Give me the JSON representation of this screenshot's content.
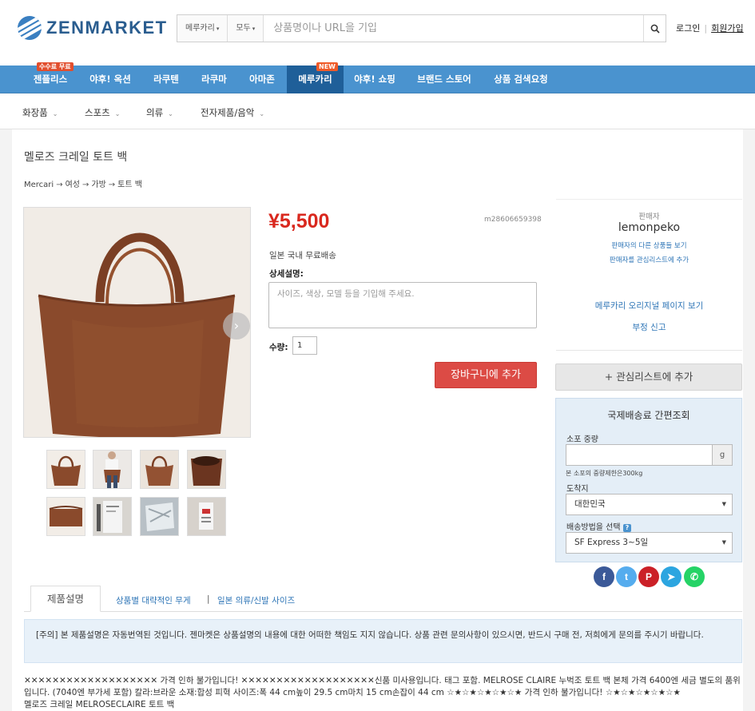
{
  "header": {
    "logo_text": "ZENMARKET",
    "search": {
      "site_select": "메루카리",
      "category_select": "모두",
      "placeholder": "상품명이나 URL을 기입"
    },
    "auth": {
      "login": "로그인",
      "separator": "|",
      "signup": "회원가입"
    }
  },
  "main_nav": {
    "items": [
      {
        "label": "젠플리스",
        "badge": "수수료 무료"
      },
      {
        "label": "야후! 옥션"
      },
      {
        "label": "라쿠텐"
      },
      {
        "label": "라쿠마"
      },
      {
        "label": "아마존"
      },
      {
        "label": "메루카리",
        "badge": "NEW",
        "active": true
      },
      {
        "label": "야후! 쇼핑"
      },
      {
        "label": "브랜드 스토어"
      },
      {
        "label": "상품 검색요청"
      }
    ]
  },
  "sub_nav": {
    "categories": [
      "화장품",
      "스포츠",
      "의류",
      "전자제품/음악"
    ]
  },
  "product": {
    "title": "멜로즈 크레일 토트 백",
    "breadcrumb": [
      "Mercari",
      "여성",
      "가방",
      "토트 백"
    ],
    "price": "¥5,500",
    "item_id": "m28606659398",
    "shipping_note": "일본 국내 무료배송",
    "details_label": "상세설명:",
    "details_placeholder": "사이즈, 색상, 모델 등을 기입해 주세요.",
    "quantity_label": "수량:",
    "quantity_value": "1",
    "add_to_cart": "장바구니에 추가",
    "image_count": 9
  },
  "seller": {
    "label": "판매자",
    "name": "lemonpeko",
    "other_items": "판매자의 다른 상품들 보기",
    "add_favorite": "판매자를 관심리스트에 추가",
    "original_page": "메루카리 오리지널 페이지 보기",
    "report": "부정 신고"
  },
  "wishlist_button": "+ 관심리스트에 추가",
  "shipping_calc": {
    "title": "국제배송료 간편조회",
    "weight_label": "소포 중량",
    "weight_unit": "g",
    "weight_note": "본 소포의 중량제한은300kg",
    "dest_label": "도착지",
    "dest_value": "대한민국",
    "method_label": "배송방법을 선택",
    "help": "?",
    "method_value": "SF Express 3~5일"
  },
  "social": [
    {
      "icon": "facebook-icon",
      "glyph": "f",
      "color": "#3b5998"
    },
    {
      "icon": "twitter-icon",
      "glyph": "t",
      "color": "#55acee"
    },
    {
      "icon": "pinterest-icon",
      "glyph": "P",
      "color": "#cb2027"
    },
    {
      "icon": "telegram-icon",
      "glyph": "➤",
      "color": "#2ca5e0"
    },
    {
      "icon": "whatsapp-icon",
      "glyph": "✆",
      "color": "#25d366"
    }
  ],
  "tabs": {
    "active": "제품설명",
    "links": [
      "상품별 대략적인 무게",
      "일본 의류/신발 사이즈"
    ],
    "separator": "|"
  },
  "notice": "[주의] 본 제품설명은 자동번역된 것입니다. 젠마켓은 상품설명의 내용에 대한 어떠한 책임도 지지 않습니다. 상품 관련 문의사항이 있으시면, 반드시 구매 전, 저희에게 문의를 주시기 바랍니다.",
  "description": [
    "✕✕✕✕✕✕✕✕✕✕✕✕✕✕✕✕✕✕✕ 가격 인하 불가입니다! ✕✕✕✕✕✕✕✕✕✕✕✕✕✕✕✕✕✕✕신품 미사용입니다. 태그 포함. MELROSE CLAIRE 누벅조 토트 백 본체 가격 6400엔 세금 별도의 품위입니다. (7040엔 부가세 포함) 칼라:브라운 소재:합성 피혁 사이즈:폭 44 cm높이 29.5 cm마치 15 cm손잡이 44 cm ☆★☆★☆★☆★☆★ 가격 인하 불가입니다! ☆★☆★☆★☆★☆★",
    "멜로즈 크레일 MELROSECLAIRE 토트 백"
  ],
  "colors": {
    "nav_blue": "#4a93cf",
    "nav_active": "#1f5f99",
    "price_red": "#d9281e",
    "cart_red": "#dc4b45",
    "link_blue": "#2f76b7",
    "bag_brown": "#8a4a2c"
  }
}
